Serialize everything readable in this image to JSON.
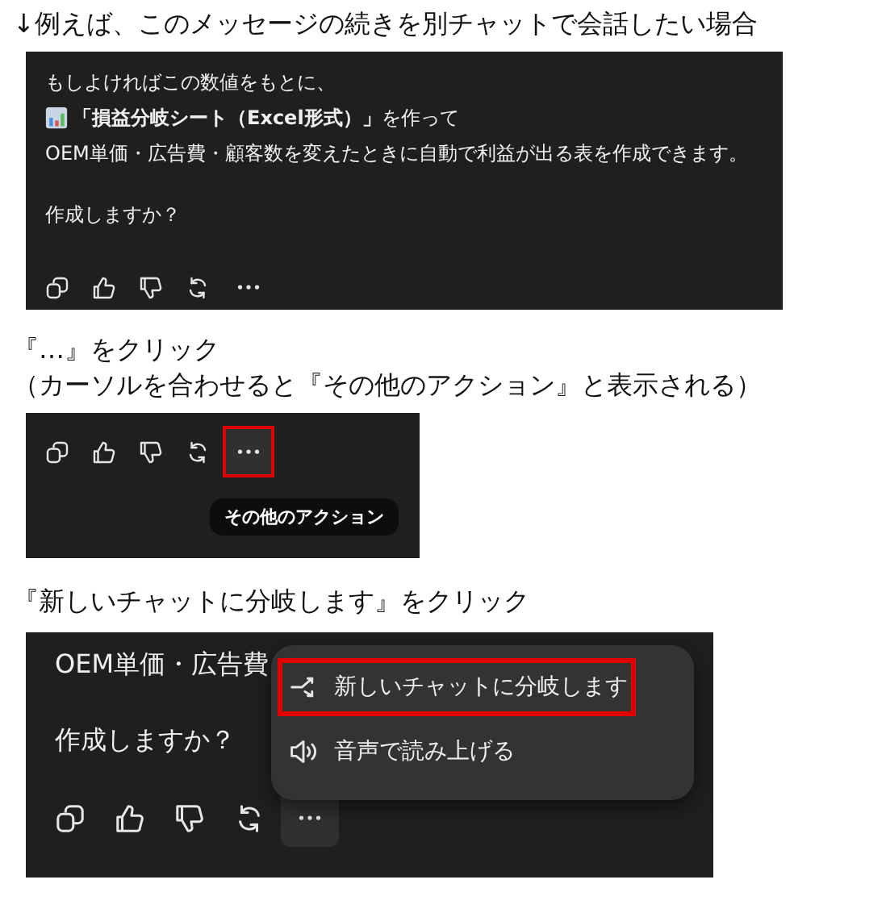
{
  "step1": {
    "caption": "↓例えば、このメッセージの続きを別チャットで会話したい場合",
    "message": [
      {
        "kind": "text",
        "text": "もしよければこの数値をもとに、"
      },
      {
        "kind": "chart-bullet",
        "text": "**「損益分岐シート（Excel形式）」**を作って"
      },
      {
        "kind": "text",
        "text": "OEM単価・広告費・顧客数を変えたときに自動で利益が出る表を作成できます。"
      },
      {
        "kind": "gap"
      },
      {
        "kind": "text",
        "text": "作成しますか？"
      }
    ],
    "more_button": {
      "hovered": false,
      "outlined": false
    }
  },
  "step2": {
    "captions": [
      "『…』をクリック",
      "（カーソルを合わせると『その他のアクション』と表示される）"
    ],
    "more_button": {
      "hovered": true,
      "outlined": true
    },
    "tooltip": "その他のアクション"
  },
  "step3": {
    "caption": "『新しいチャットに分岐します』をクリック",
    "message": [
      {
        "kind": "text",
        "text": "OEM単価・広告費"
      },
      {
        "kind": "gap"
      },
      {
        "kind": "text",
        "text": "作成しますか？"
      }
    ],
    "menu": [
      {
        "kind": "branch",
        "label": "新しいチャットに分岐します",
        "outlined": true
      },
      {
        "kind": "speaker",
        "label": "音声で読み上げる",
        "outlined": false
      }
    ],
    "more_button": {
      "hovered": true,
      "outlined": false
    }
  }
}
